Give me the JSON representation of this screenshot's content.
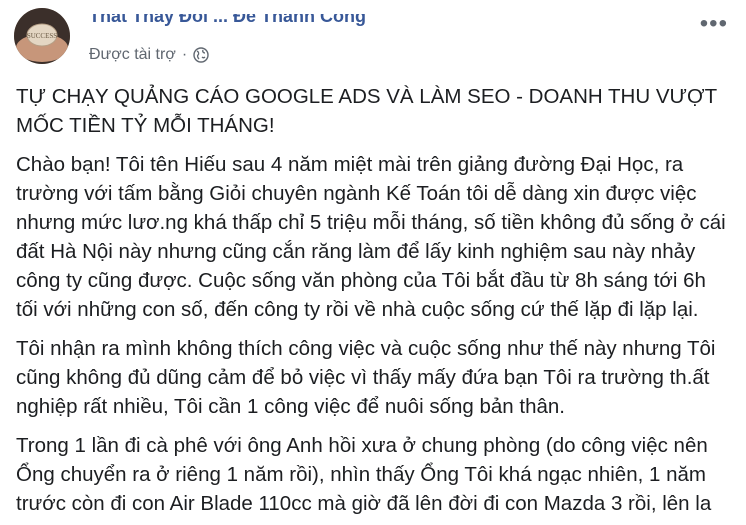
{
  "post": {
    "page_name": "Thất Thay Đổi ... Để Thành Công",
    "sponsored": "Được tài trợ",
    "separator": "·",
    "headline": "TỰ CHẠY QUẢNG CÁO GOOGLE ADS VÀ LÀM SEO - DOANH THU VƯỢT MỐC TIỀN TỶ MỖI THÁNG!",
    "paragraphs": [
      "Chào bạn! Tôi tên Hiếu sau 4 năm miệt mài trên giảng đường Đại Học, ra trường với tấm bằng Giỏi chuyên ngành Kế Toán tôi dễ dàng xin được việc nhưng mức lươ.ng khá thấp chỉ 5 triệu mỗi tháng, số tiền không đủ sống ở cái đất Hà Nội này nhưng cũng cắn răng làm để lấy kinh nghiệm sau này nhảy công ty cũng được. Cuộc sống văn phòng của Tôi bắt đầu từ 8h sáng tới 6h tối với những con số, đến công ty rồi về nhà cuộc sống cứ thế lặp đi lặp lại.",
      "Tôi nhận ra mình không thích công việc và cuộc sống như thế này nhưng Tôi cũng không đủ dũng cảm để bỏ việc vì thấy mấy đứa bạn Tôi ra trường th.ất nghiệp rất nhiều, Tôi cần 1 công việc để nuôi sống bản thân.",
      "Trong 1 lần đi cà phê với ông Anh hồi xưa ở chung phòng (do công việc nên Ổng chuyển ra ở riêng 1 năm rồi), nhìn thấy Ổng Tôi khá ngạc nhiên, 1 năm trước còn đi con Air Blade 110cc mà giờ đã lên đời đi con Mazda 3 rồi, lên la"
    ],
    "avatar_text": "SUCCESS"
  }
}
